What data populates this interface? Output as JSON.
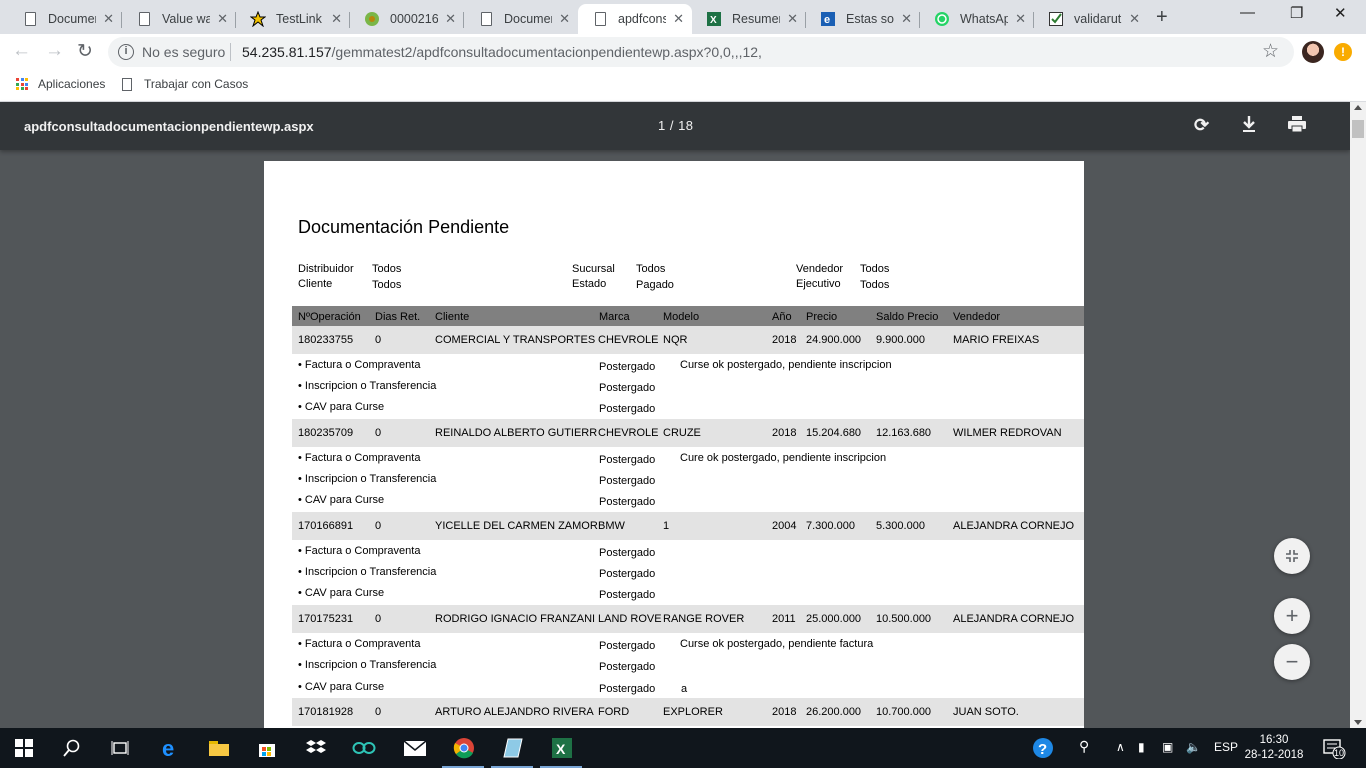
{
  "browser": {
    "tabs": [
      {
        "title": "Documen",
        "icon": "document-icon"
      },
      {
        "title": "Value wa",
        "icon": "document-icon"
      },
      {
        "title": "TestLink",
        "icon": "testlink-icon"
      },
      {
        "title": "0000216",
        "icon": "mantis-icon"
      },
      {
        "title": "Documen",
        "icon": "document-icon"
      },
      {
        "title": "apdfcons",
        "icon": "document-icon"
      },
      {
        "title": "Resumen",
        "icon": "excel-icon"
      },
      {
        "title": "Estas son",
        "icon": "ie-icon"
      },
      {
        "title": "WhatsAp",
        "icon": "whatsapp-icon"
      },
      {
        "title": "validarut",
        "icon": "checkmark-icon"
      }
    ],
    "active_tab": 5,
    "security_label": "No es seguro",
    "url_host": "54.235.81.157",
    "url_path": "/gemmatest2/apdfconsultadocumentacionpendientewp.aspx?0,0,,,12,",
    "bookmarks": [
      {
        "label": "Aplicaciones"
      },
      {
        "label": "Trabajar con Casos"
      }
    ]
  },
  "pdf": {
    "filename": "apdfconsultadocumentacionpendientewp.aspx",
    "current_page": "1",
    "total_pages": "18",
    "page_indicator": "1  /  18"
  },
  "report": {
    "title": "Documentación Pendiente",
    "filters": {
      "distribuidor_label": "Distribuidor",
      "distribuidor": "Todos",
      "cliente_label": "Cliente",
      "cliente": "Todos",
      "sucursal_label": "Sucursal",
      "sucursal": "Todos",
      "estado_label": "Estado",
      "estado": "Pagado",
      "vendedor_label": "Vendedor",
      "vendedor": "Todos",
      "ejecutivo_label": "Ejecutivo",
      "ejecutivo": "Todos"
    },
    "headers": [
      "NºOperación",
      "Dias Ret.",
      "Cliente",
      "Marca",
      "Modelo",
      "Año",
      "Precio",
      "Saldo Precio",
      "Vendedor"
    ],
    "records": [
      {
        "cells": [
          "180233755",
          "0",
          "COMERCIAL Y TRANSPORTES S",
          "CHEVROLE",
          "NQR",
          "2018",
          "24.900.000",
          "9.900.000",
          "MARIO FREIXAS"
        ],
        "docs": [
          {
            "name": "• Factura o Compraventa",
            "status": "Postergado",
            "note": "Curse ok postergado, pendiente inscripcion"
          },
          {
            "name": "• Inscripcion o Transferencia",
            "status": "Postergado",
            "note": ""
          },
          {
            "name": "• CAV para Curse",
            "status": "Postergado",
            "note": ""
          }
        ]
      },
      {
        "cells": [
          "180235709",
          "0",
          "REINALDO ALBERTO GUTIERRE",
          "CHEVROLE",
          "CRUZE",
          "2018",
          "15.204.680",
          "12.163.680",
          "WILMER REDROVAN"
        ],
        "docs": [
          {
            "name": "• Factura o Compraventa",
            "status": "Postergado",
            "note": "Cure ok postergado, pendiente inscripcion"
          },
          {
            "name": "• Inscripcion o Transferencia",
            "status": "Postergado",
            "note": ""
          },
          {
            "name": "• CAV para Curse",
            "status": "Postergado",
            "note": ""
          }
        ]
      },
      {
        "cells": [
          "170166891",
          "0",
          "YICELLE DEL CARMEN ZAMORA",
          "BMW",
          "1",
          "2004",
          "7.300.000",
          "5.300.000",
          "ALEJANDRA CORNEJO"
        ],
        "docs": [
          {
            "name": "• Factura o Compraventa",
            "status": "Postergado",
            "note": ""
          },
          {
            "name": "• Inscripcion o Transferencia",
            "status": "Postergado",
            "note": ""
          },
          {
            "name": "• CAV para Curse",
            "status": "Postergado",
            "note": ""
          }
        ]
      },
      {
        "cells": [
          "170175231",
          "0",
          "RODRIGO IGNACIO FRANZANI",
          "LAND ROVE",
          "RANGE ROVER",
          "2011",
          "25.000.000",
          "10.500.000",
          "ALEJANDRA CORNEJO"
        ],
        "docs": [
          {
            "name": "• Factura o Compraventa",
            "status": "Postergado",
            "note": "Curse ok postergado, pendiente factura"
          },
          {
            "name": "• Inscripcion o Transferencia",
            "status": "Postergado",
            "note": ""
          },
          {
            "name": "• CAV para Curse",
            "status": "Postergado",
            "note": "a"
          }
        ]
      },
      {
        "cells": [
          "170181928",
          "0",
          "ARTURO ALEJANDRO RIVERA",
          "FORD",
          "EXPLORER",
          "2018",
          "26.200.000",
          "10.700.000",
          "JUAN SOTO."
        ],
        "docs": []
      }
    ]
  },
  "taskbar": {
    "language": "ESP",
    "time": "16:30",
    "date": "28-12-2018",
    "notifications": "10"
  },
  "colors": {
    "pdf_background": "#525659",
    "pdf_toolbar": "#323639",
    "record_row": "#e3e3e3",
    "column_header": "#808080"
  }
}
